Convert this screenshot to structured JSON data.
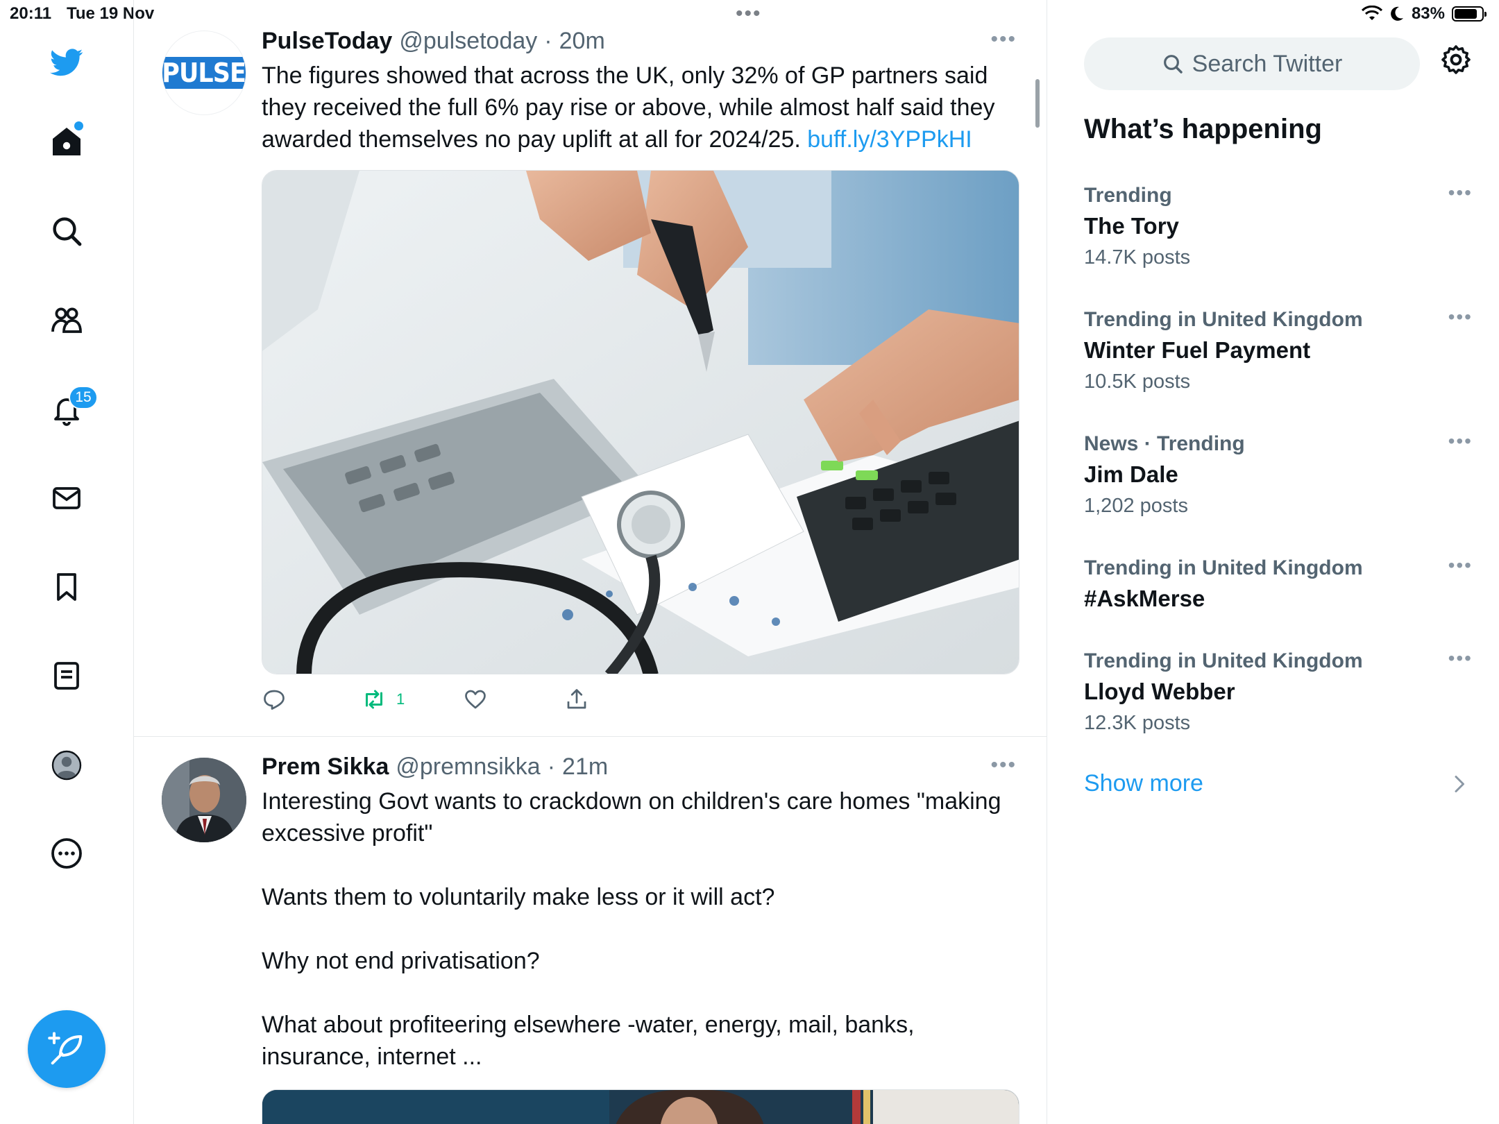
{
  "status_bar": {
    "time": "20:11",
    "date": "Tue 19 Nov",
    "battery": "83%",
    "battery_level": 0.83
  },
  "nav": {
    "notifications_badge": "15"
  },
  "tweets": [
    {
      "name": "PulseToday",
      "handle": "@pulsetoday",
      "separator": "·",
      "time": "20m",
      "avatar_text": "PULSE",
      "text": "The figures showed that across the UK, only 32% of GP partners said they received the full 6% pay rise or above, while almost half said they awarded themselves no pay uplift at all for 2024/25. ",
      "link": "buff.ly/3YPPkHI",
      "retweet_count": "1"
    },
    {
      "name": "Prem Sikka",
      "handle": "@premnsikka",
      "separator": "·",
      "time": "21m",
      "text": "Interesting Govt wants to crackdown on children's care homes \"making excessive profit\"\n\nWants them to voluntarily make less or it will act?\n\nWhy not end privatisation?\n\nWhat about profiteering elsewhere -water, energy, mail, banks, insurance, internet ..."
    }
  ],
  "sidebar": {
    "search_placeholder": "Search Twitter",
    "title": "What’s happening",
    "trends": [
      {
        "meta": "Trending",
        "name": "The Tory",
        "count": "14.7K posts"
      },
      {
        "meta": "Trending in United Kingdom",
        "name": "Winter Fuel Payment",
        "count": "10.5K posts"
      },
      {
        "meta": "News · Trending",
        "name": "Jim Dale",
        "count": "1,202 posts"
      },
      {
        "meta": "Trending in United Kingdom",
        "name": "#AskMerse",
        "count": ""
      },
      {
        "meta": "Trending in United Kingdom",
        "name": "Lloyd Webber",
        "count": "12.3K posts"
      }
    ],
    "show_more": "Show more"
  },
  "colors": {
    "accent": "#1d9bf0",
    "retweet": "#00ba7c",
    "secondary_text": "#536471"
  }
}
